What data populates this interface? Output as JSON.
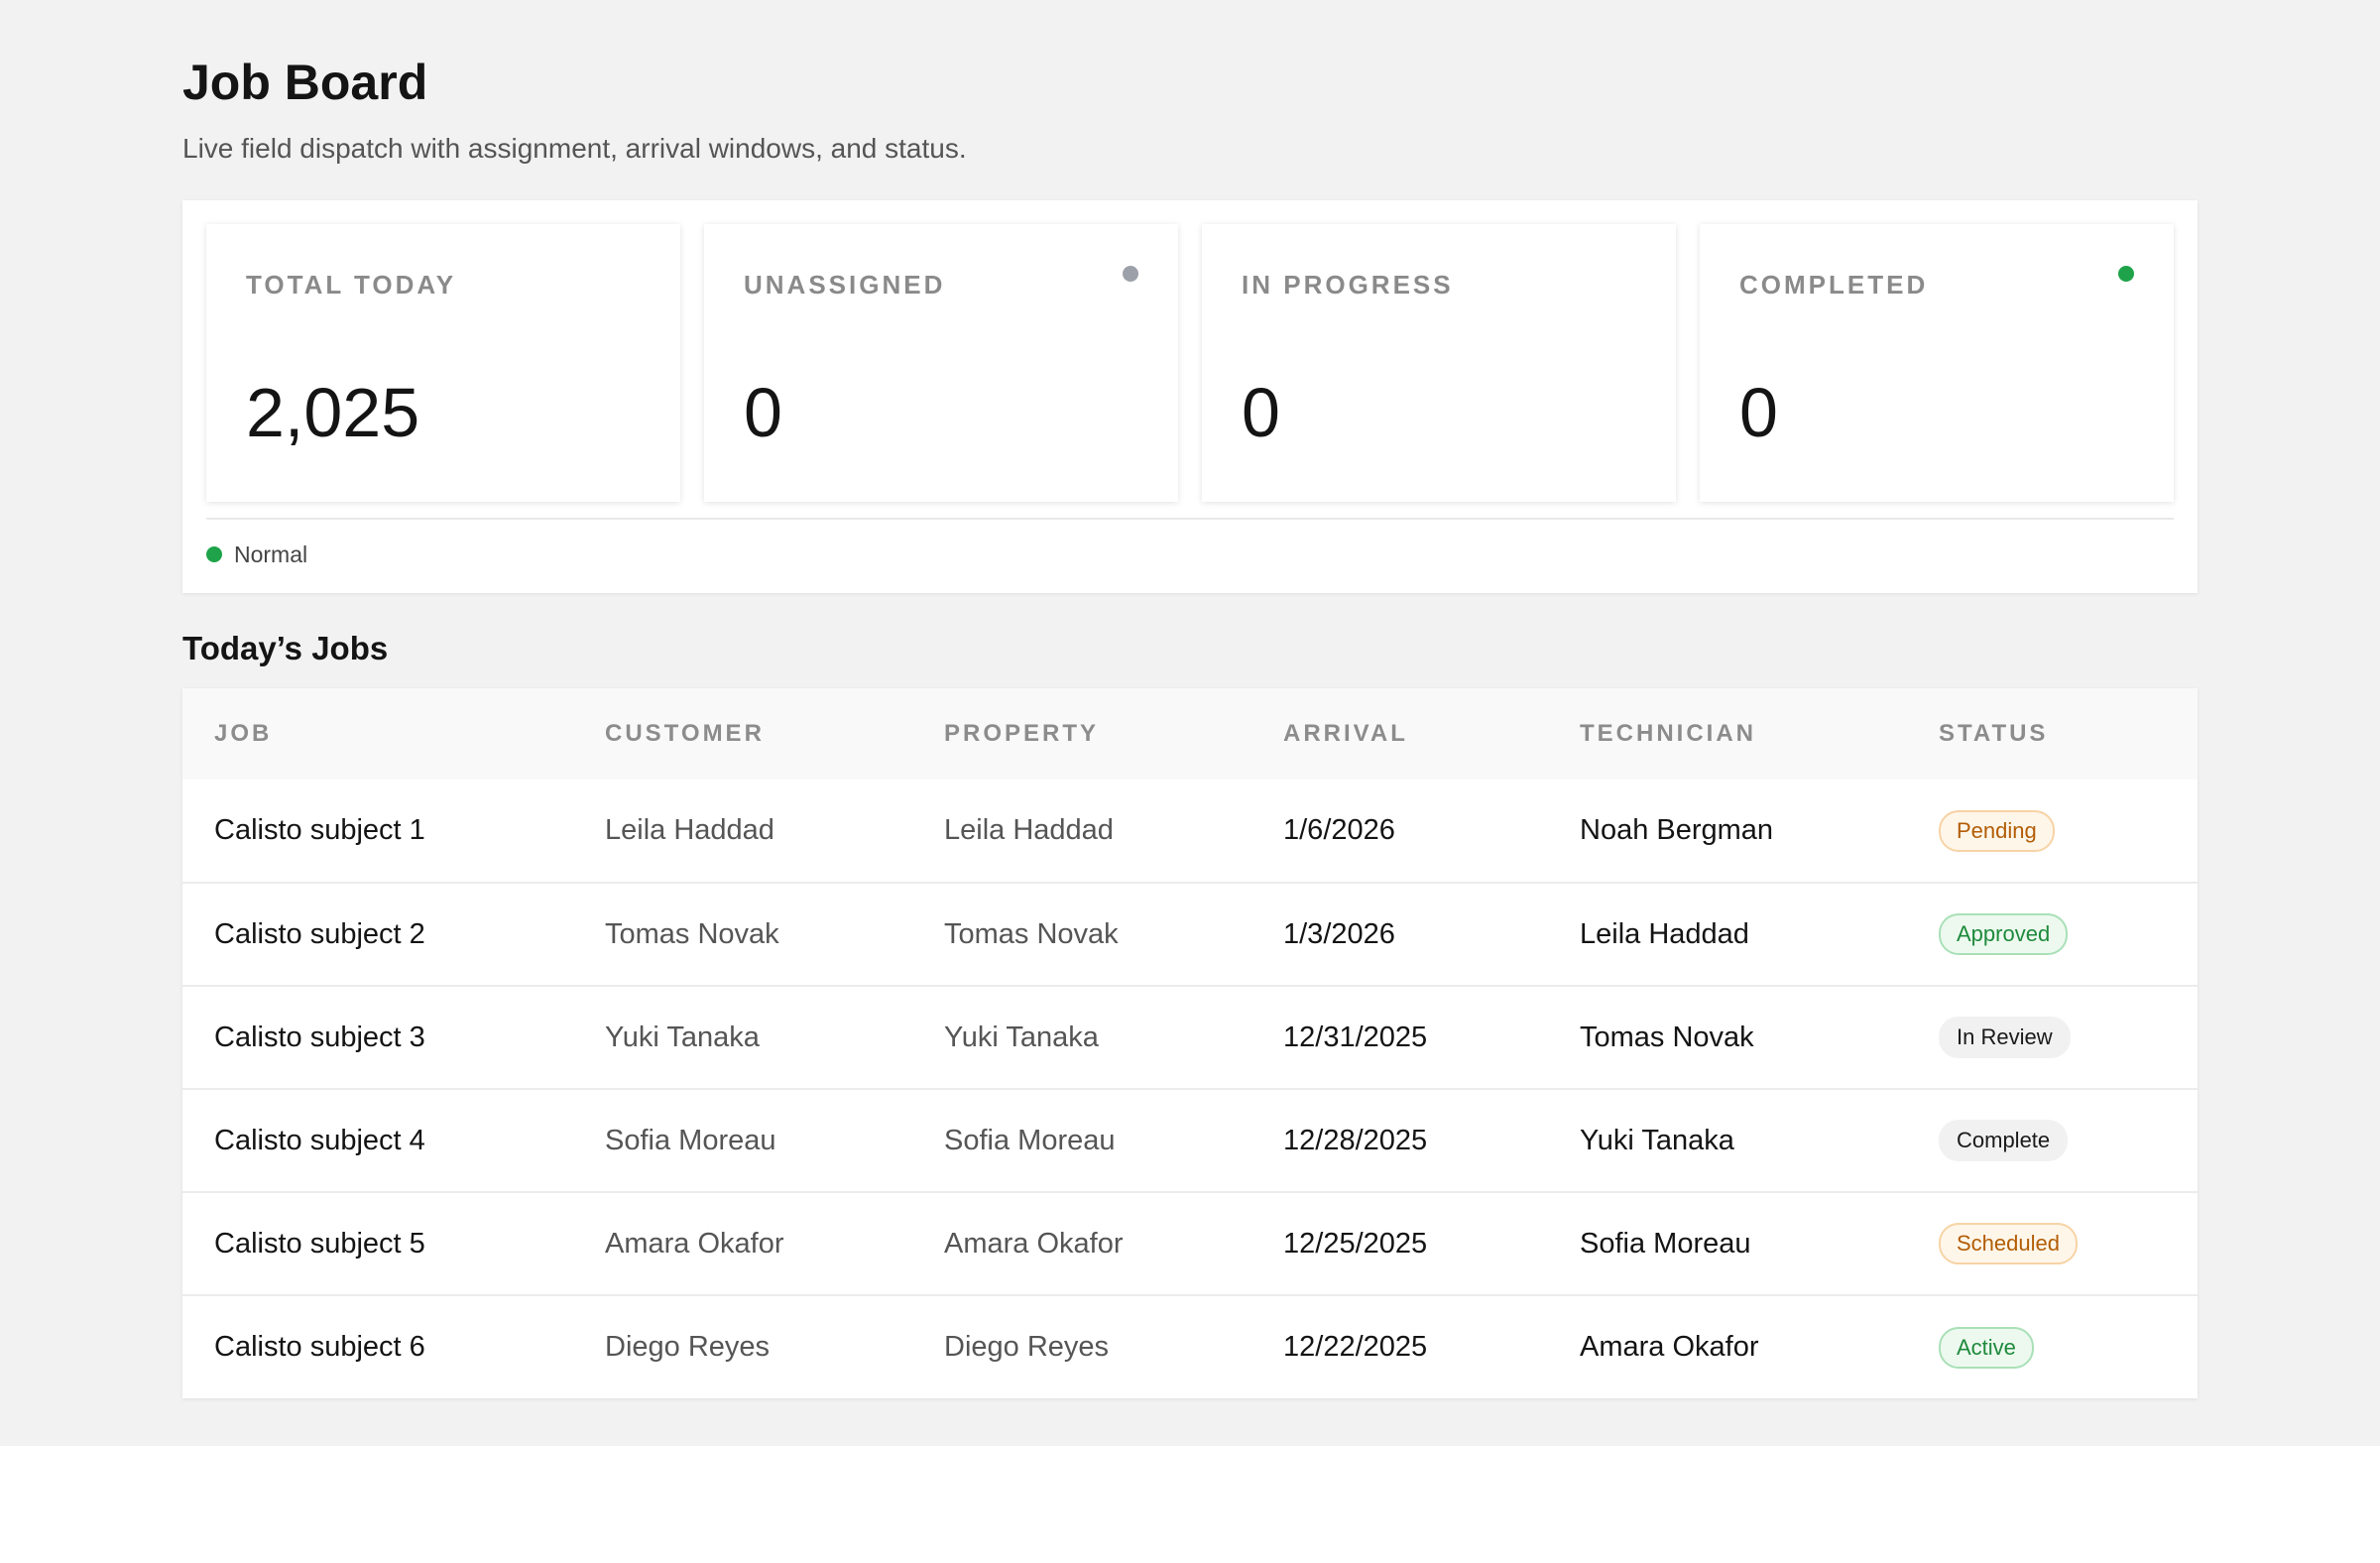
{
  "header": {
    "title": "Job Board",
    "subtitle": "Live field dispatch with assignment, arrival windows, and status."
  },
  "stats": [
    {
      "label": "TOTAL TODAY",
      "value": "2,025",
      "dot_color": null
    },
    {
      "label": "UNASSIGNED",
      "value": "0",
      "dot_color": "#9ca0a8"
    },
    {
      "label": "IN PROGRESS",
      "value": "0",
      "dot_color": null
    },
    {
      "label": "COMPLETED",
      "value": "0",
      "dot_color": "#1fa34a"
    }
  ],
  "health": {
    "label": "Normal",
    "color": "#1fa34a"
  },
  "jobs_section": {
    "title": "Today’s Jobs",
    "columns": [
      "JOB",
      "CUSTOMER",
      "PROPERTY",
      "ARRIVAL",
      "TECHNICIAN",
      "STATUS"
    ],
    "rows": [
      {
        "job": "Calisto subject 1",
        "customer": "Leila Haddad",
        "property": "Leila Haddad",
        "arrival": "1/6/2026",
        "technician": "Noah Bergman",
        "status": "Pending",
        "status_kind": "pending"
      },
      {
        "job": "Calisto subject 2",
        "customer": "Tomas Novak",
        "property": "Tomas Novak",
        "arrival": "1/3/2026",
        "technician": "Leila Haddad",
        "status": "Approved",
        "status_kind": "approved"
      },
      {
        "job": "Calisto subject 3",
        "customer": "Yuki Tanaka",
        "property": "Yuki Tanaka",
        "arrival": "12/31/2025",
        "technician": "Tomas Novak",
        "status": "In Review",
        "status_kind": "review"
      },
      {
        "job": "Calisto subject 4",
        "customer": "Sofia Moreau",
        "property": "Sofia Moreau",
        "arrival": "12/28/2025",
        "technician": "Yuki Tanaka",
        "status": "Complete",
        "status_kind": "complete"
      },
      {
        "job": "Calisto subject 5",
        "customer": "Amara Okafor",
        "property": "Amara Okafor",
        "arrival": "12/25/2025",
        "technician": "Sofia Moreau",
        "status": "Scheduled",
        "status_kind": "scheduled"
      },
      {
        "job": "Calisto subject 6",
        "customer": "Diego Reyes",
        "property": "Diego Reyes",
        "arrival": "12/22/2025",
        "technician": "Amara Okafor",
        "status": "Active",
        "status_kind": "active"
      }
    ]
  }
}
